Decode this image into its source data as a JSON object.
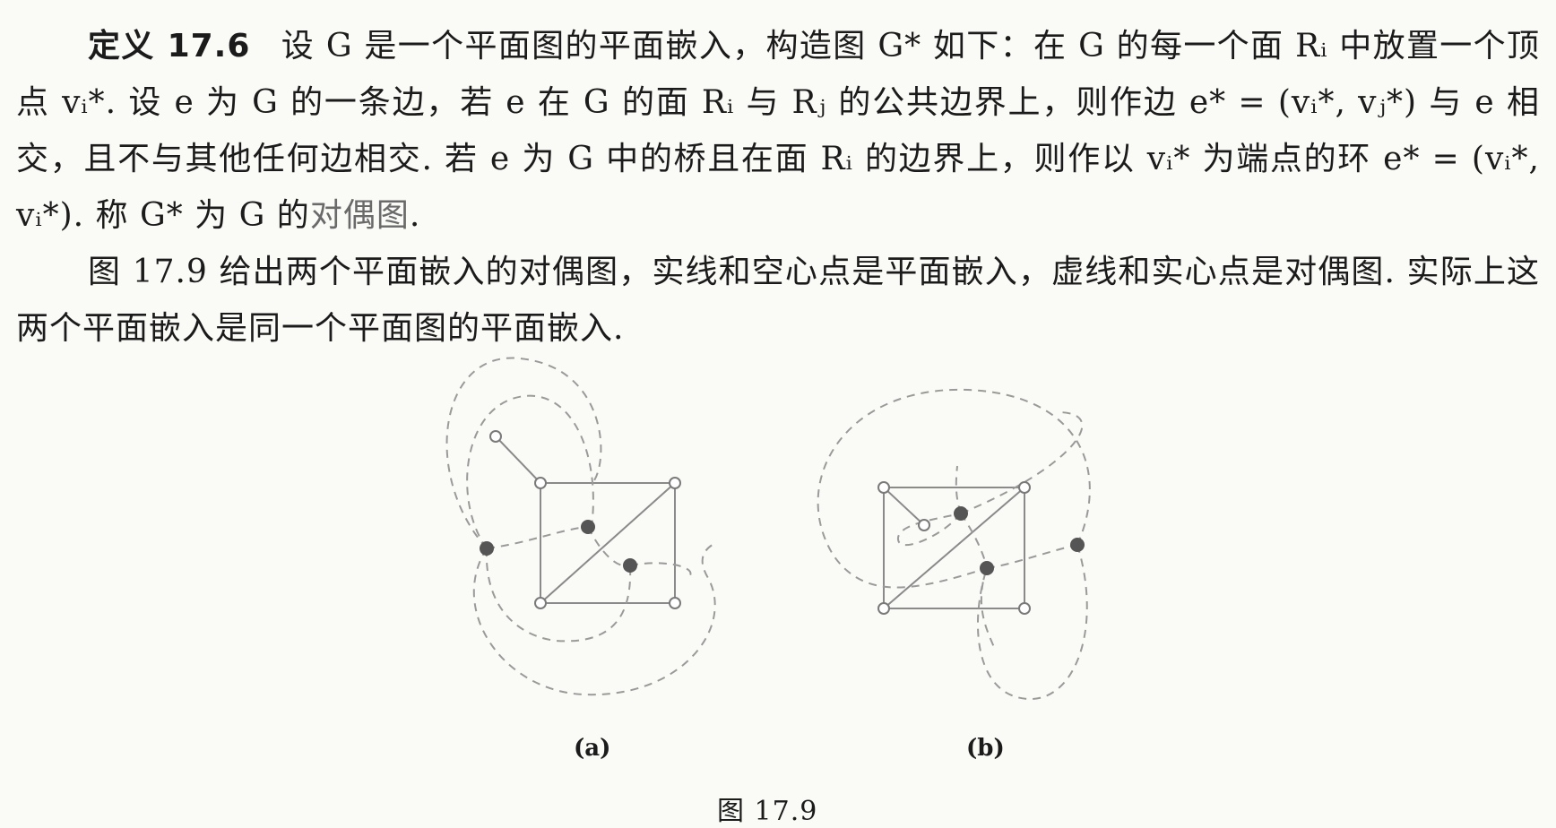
{
  "definition": {
    "label": "定义 17.6",
    "body": "设 G 是一个平面图的平面嵌入，构造图 G* 如下：在 G 的每一个面 Rᵢ 中放置一个顶点 vᵢ*. 设 e 为 G 的一条边，若 e 在 G 的面 Rᵢ 与 Rⱼ 的公共边界上，则作边 e* = (vᵢ*, vⱼ*) 与 e 相交，且不与其他任何边相交. 若 e 为 G 中的桥且在面 Rᵢ 的边界上，则作以 vᵢ* 为端点的环 e* = (vᵢ*, vᵢ*). 称 G* 为 G 的",
    "term": "对偶图",
    "end": "."
  },
  "paragraph2": "图 17.9 给出两个平面嵌入的对偶图，实线和空心点是平面嵌入，虚线和实心点是对偶图. 实际上这两个平面嵌入是同一个平面图的平面嵌入.",
  "figure": {
    "caption": "图 17.9",
    "subfigure_a_label": "(a)",
    "subfigure_b_label": "(b)"
  }
}
